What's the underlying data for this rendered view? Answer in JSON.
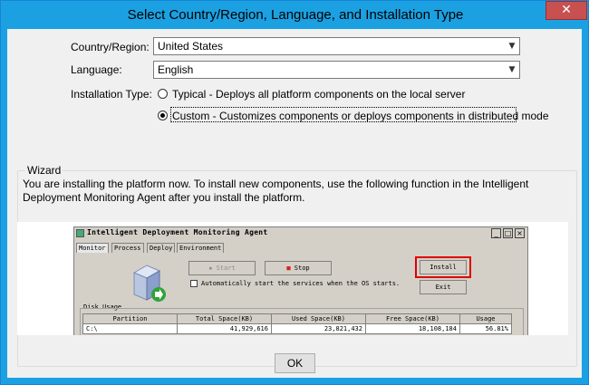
{
  "window": {
    "title": "Select Country/Region, Language, and Installation Type",
    "close_label": "✕"
  },
  "form": {
    "country_label": "Country/Region:",
    "country_value": "United States",
    "language_label": "Language:",
    "language_value": "English",
    "install_type_label": "Installation Type:",
    "install_options": [
      {
        "label": "Typical - Deploys all platform components on the local server",
        "selected": false
      },
      {
        "label": "Custom - Customizes components or deploys components in distributed mode",
        "selected": true
      }
    ]
  },
  "wizard": {
    "title": "Wizard",
    "text": "You are installing the platform now. To install new components, use the following function in the Intelligent Deployment Monitoring Agent after you install the platform."
  },
  "embedded": {
    "title": "Intelligent Deployment Monitoring Agent",
    "tabs": [
      "Monitor",
      "Process",
      "Deploy",
      "Environment"
    ],
    "start_label": "Start",
    "stop_label": "Stop",
    "install_label": "Install",
    "exit_label": "Exit",
    "autostart_label": "Automatically start the services when the OS starts.",
    "disk_usage_label": "Disk Usage",
    "table": {
      "headers": [
        "Partition",
        "Total Space(KB)",
        "Used Space(KB)",
        "Free Space(KB)",
        "Usage"
      ],
      "rows": [
        [
          "C:\\",
          "41,929,616",
          "23,821,432",
          "18,108,184",
          "56.81%"
        ]
      ]
    }
  },
  "footer": {
    "ok_label": "OK"
  }
}
